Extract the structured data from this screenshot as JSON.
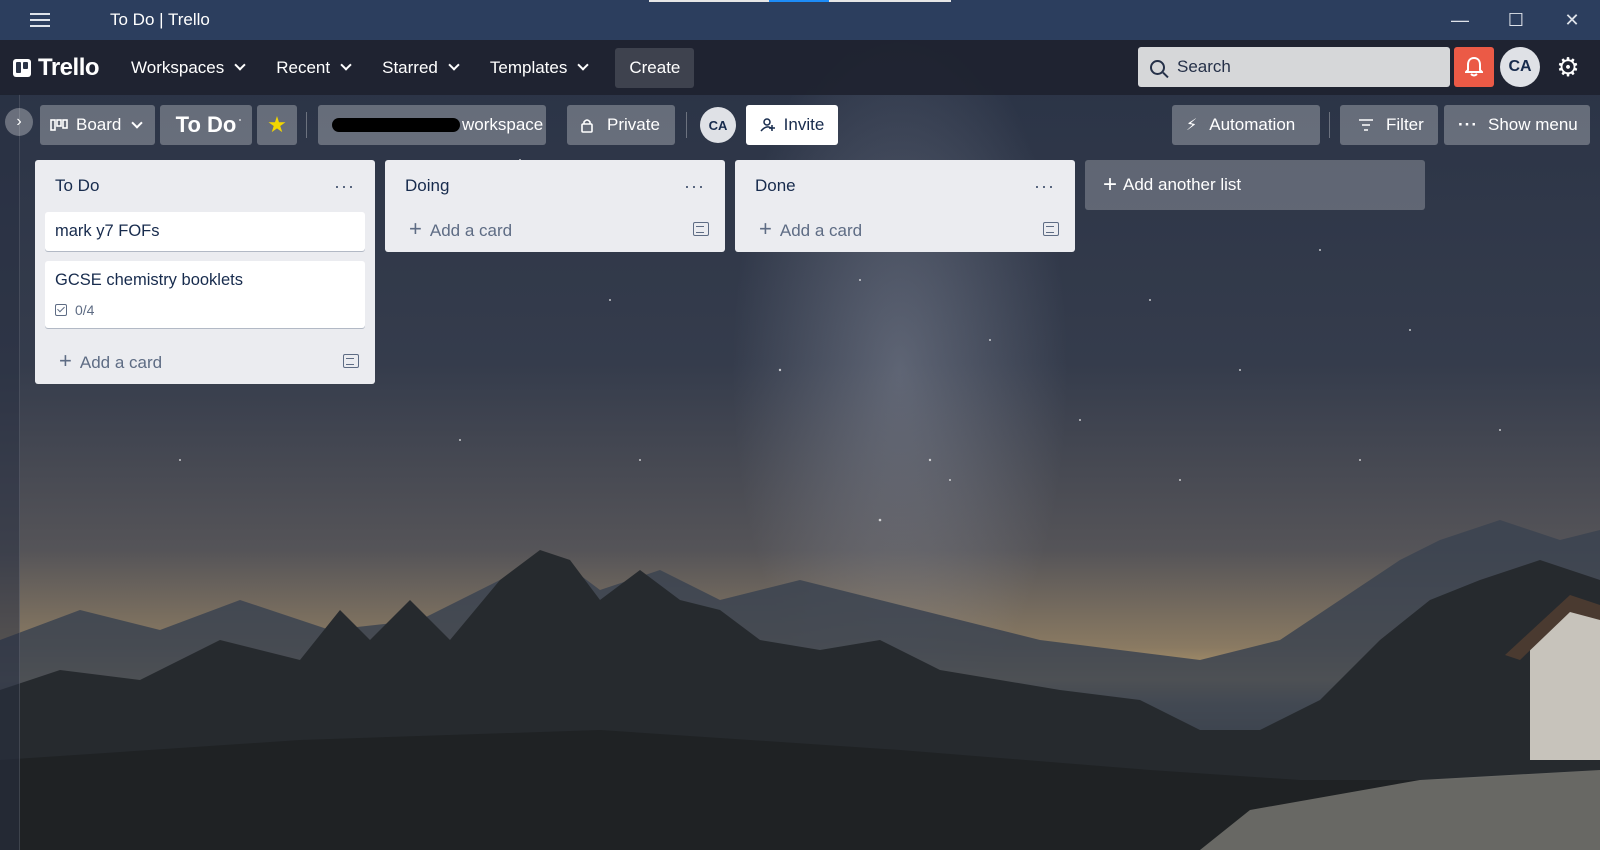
{
  "window": {
    "title": "To Do | Trello",
    "controls": [
      "minimize",
      "maximize",
      "close"
    ]
  },
  "topnav": {
    "logo": "Trello",
    "items": [
      {
        "label": "Workspaces"
      },
      {
        "label": "Recent"
      },
      {
        "label": "Starred"
      },
      {
        "label": "Templates"
      }
    ],
    "create_label": "Create",
    "search_placeholder": "Search",
    "avatar_initials": "CA",
    "accent_notification": "#eb5a46"
  },
  "board_header": {
    "view_label": "Board",
    "board_title": "To Do",
    "workspace_label": "workspace",
    "visibility_label": "Private",
    "member_initials": "CA",
    "invite_label": "Invite",
    "automation_label": "Automation",
    "filter_label": "Filter",
    "show_menu_label": "Show menu"
  },
  "lists": [
    {
      "title": "To Do",
      "cards": [
        {
          "title": "mark y7 FOFs"
        },
        {
          "title": "GCSE chemistry booklets",
          "checklist": "0/4"
        }
      ],
      "add_card_label": "Add a card"
    },
    {
      "title": "Doing",
      "cards": [],
      "add_card_label": "Add a card"
    },
    {
      "title": "Done",
      "cards": [],
      "add_card_label": "Add a card"
    }
  ],
  "add_list_label": "Add another list"
}
